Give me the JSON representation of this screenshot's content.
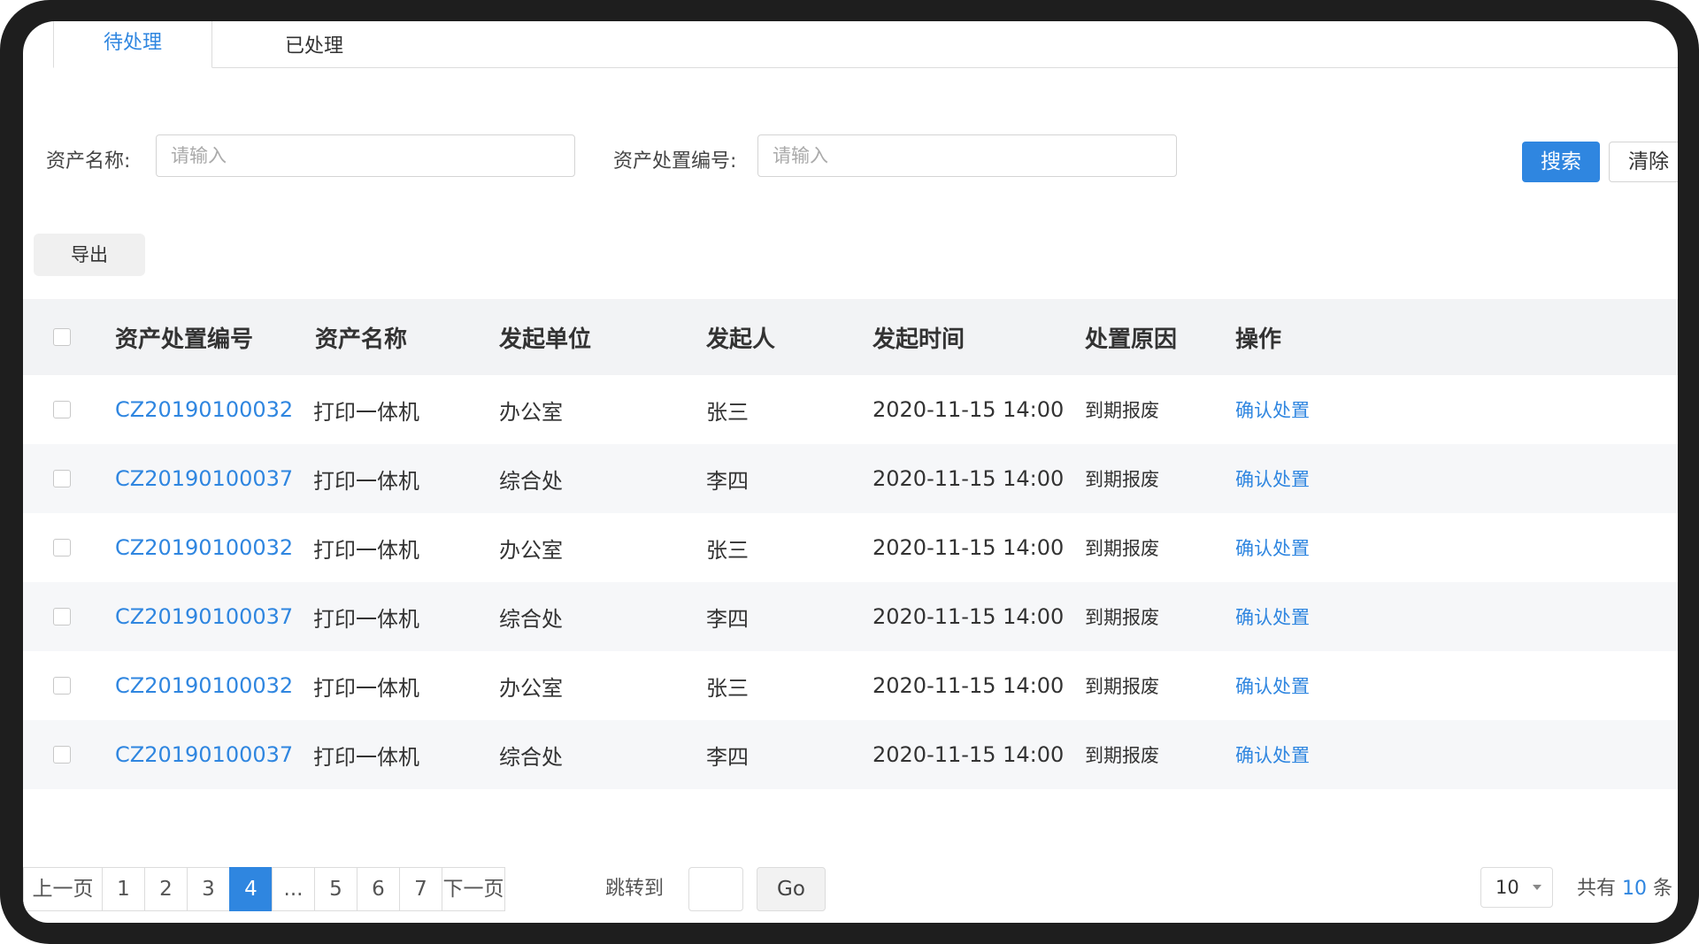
{
  "tabs": [
    {
      "label": "待处理",
      "active": true
    },
    {
      "label": "已处理",
      "active": false
    }
  ],
  "search": {
    "asset_name_label": "资产名称:",
    "asset_name_placeholder": "请输入",
    "disposal_no_label": "资产处置编号:",
    "disposal_no_placeholder": "请输入",
    "search_button": "搜索",
    "clear_button": "清除"
  },
  "toolbar": {
    "export_button": "导出"
  },
  "table": {
    "columns": [
      "资产处置编号",
      "资产名称",
      "发起单位",
      "发起人",
      "发起时间",
      "处置原因",
      "操作"
    ],
    "rows": [
      {
        "no": "CZ20190100032",
        "name": "打印一体机",
        "unit": "办公室",
        "person": "张三",
        "time": "2020-11-15  14:00",
        "reason": "到期报废",
        "action": "确认处置"
      },
      {
        "no": "CZ20190100037",
        "name": "打印一体机",
        "unit": "综合处",
        "person": "李四",
        "time": "2020-11-15  14:00",
        "reason": "到期报废",
        "action": "确认处置"
      },
      {
        "no": "CZ20190100032",
        "name": "打印一体机",
        "unit": "办公室",
        "person": "张三",
        "time": "2020-11-15  14:00",
        "reason": "到期报废",
        "action": "确认处置"
      },
      {
        "no": "CZ20190100037",
        "name": "打印一体机",
        "unit": "综合处",
        "person": "李四",
        "time": "2020-11-15  14:00",
        "reason": "到期报废",
        "action": "确认处置"
      },
      {
        "no": "CZ20190100032",
        "name": "打印一体机",
        "unit": "办公室",
        "person": "张三",
        "time": "2020-11-15  14:00",
        "reason": "到期报废",
        "action": "确认处置"
      },
      {
        "no": "CZ20190100037",
        "name": "打印一体机",
        "unit": "综合处",
        "person": "李四",
        "time": "2020-11-15  14:00",
        "reason": "到期报废",
        "action": "确认处置"
      }
    ]
  },
  "pagination": {
    "prev": "上一页",
    "pages": [
      "1",
      "2",
      "3",
      "4",
      "...",
      "5",
      "6",
      "7"
    ],
    "current": "4",
    "next": "下一页",
    "jump_label": "跳转到",
    "go_button": "Go",
    "page_size": "10",
    "total_prefix": "共有",
    "total_count": "10",
    "total_suffix": "条"
  },
  "colors": {
    "accent": "#2f86e0",
    "frame": "#1e1e1e",
    "header_bg": "#f2f3f5"
  }
}
